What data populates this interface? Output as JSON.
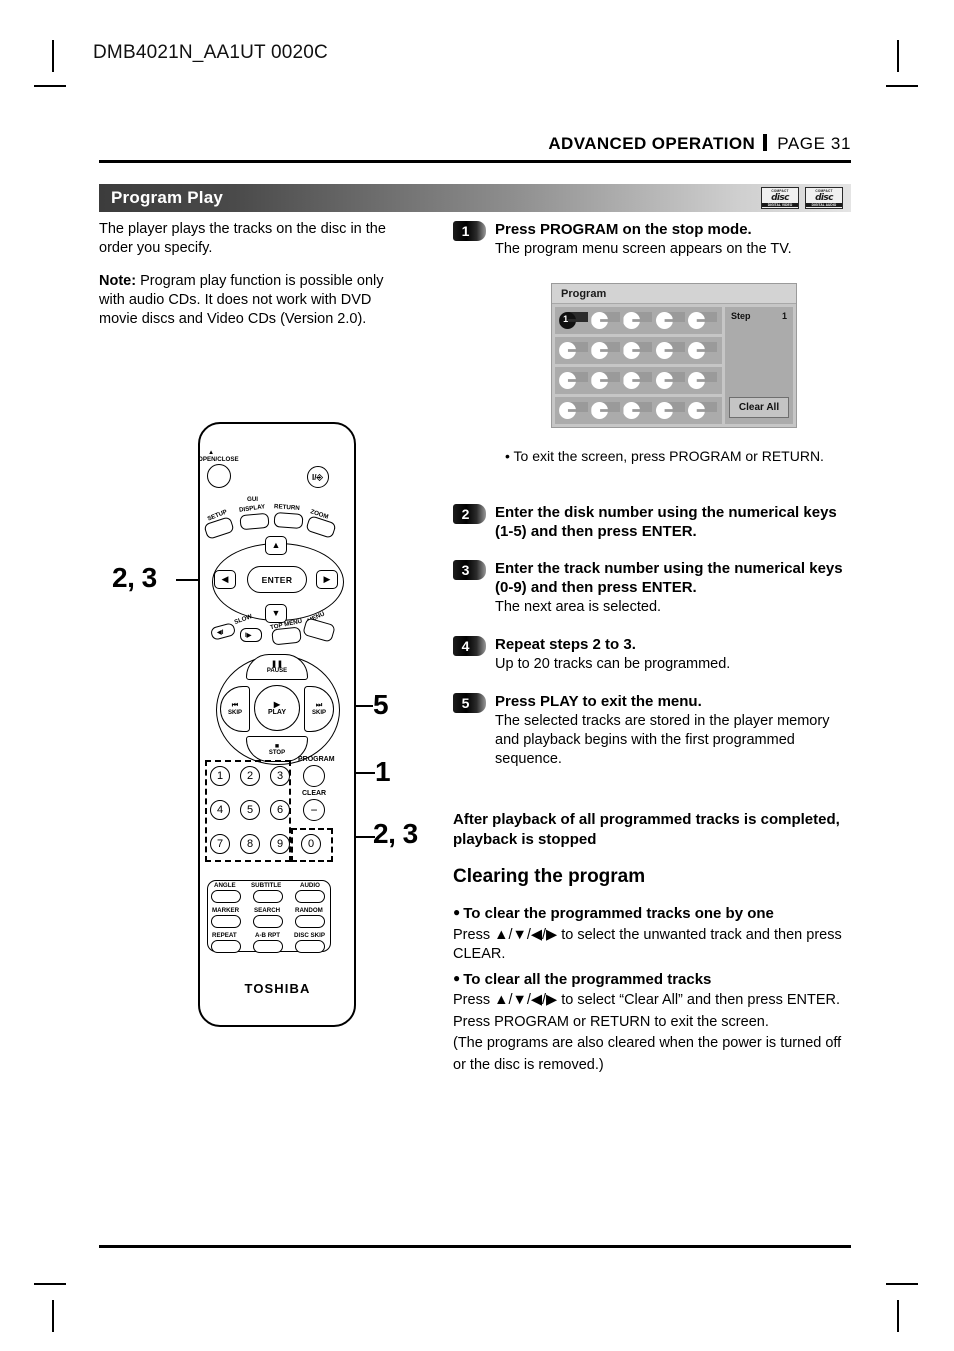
{
  "document": {
    "code": "DMB4021N_AA1UT 0020C",
    "section": "ADVANCED OPERATION",
    "page_label": "PAGE 31"
  },
  "title_bar": {
    "title": "Program Play",
    "logos": [
      {
        "name": "cd-video-logo",
        "top": "COMPACT",
        "word": "disc",
        "bottom": "DIGITAL VIDEO"
      },
      {
        "name": "cd-audio-logo",
        "top": "COMPACT",
        "word": "disc",
        "bottom": "DIGITAL AUDIO"
      }
    ]
  },
  "intro": {
    "paragraph": "The player plays the tracks on the disc in the order you specify.",
    "note_label": "Note:",
    "note_text": " Program play function is possible only with audio CDs. It does not work with DVD movie discs and Video CDs (Version 2.0)."
  },
  "steps": [
    {
      "number": "1",
      "title": "Press PROGRAM on the stop mode.",
      "body": "The program menu screen appears on the TV."
    },
    {
      "number": "2",
      "title": "Enter the disk number using the numerical keys (1-5) and then press ENTER.",
      "body": ""
    },
    {
      "number": "3",
      "title": "Enter the track number using the numerical keys (0-9) and then press ENTER.",
      "body": "The next area is selected."
    },
    {
      "number": "4",
      "title": "Repeat steps 2 to 3.",
      "body": "Up to 20 tracks can be programmed."
    },
    {
      "number": "5",
      "title": "Press PLAY to exit the menu.",
      "body": "The selected tracks are stored in the player memory and playback begins with the first programmed sequence."
    }
  ],
  "tv_screen": {
    "title": "Program",
    "step_label": "Step",
    "step_value": "1",
    "clear_all": "Clear All",
    "selected_cell_number": "1",
    "rows": 4,
    "cols": 5
  },
  "tv_note": "• To exit the screen, press PROGRAM or RETURN.",
  "after_note": "After playback of all programmed tracks is completed, playback is stopped",
  "clearing": {
    "heading": "Clearing the program",
    "bullet_one": "To clear the programmed tracks one by one",
    "body_one": "Press ▲/▼/◀/▶ to select the unwanted track and then press CLEAR.",
    "bullet_two": "To clear all the programmed tracks",
    "body_two_line1": "Press ▲/▼/◀/▶ to select “Clear All” and then press ENTER.",
    "body_two_line2": "Press PROGRAM or RETURN to exit the screen.",
    "body_two_line3": "(The programs are also cleared when the power is turned off",
    "body_two_line4": "or the disc is removed.)"
  },
  "callouts": [
    {
      "name": "callout-enter",
      "label": "2, 3"
    },
    {
      "name": "callout-play",
      "label": "5"
    },
    {
      "name": "callout-program",
      "label": "1"
    },
    {
      "name": "callout-numeric",
      "label": "2, 3"
    }
  ],
  "remote": {
    "brand": "TOSHIBA",
    "open_close": "OPEN/CLOSE",
    "power": "I/⏻",
    "row_setup": [
      "SETUP",
      "GUI",
      "DISPLAY",
      "RETURN",
      "ZOOM"
    ],
    "enter": "ENTER",
    "slow": "SLOW",
    "top_menu": "TOP MENU",
    "menu": "MENU",
    "pause": "PAUSE",
    "skip_left": "SKIP",
    "skip_right": "SKIP",
    "play": "PLAY",
    "stop": "STOP",
    "program": "PROGRAM",
    "clear": "CLEAR",
    "numeric_keys": [
      "1",
      "2",
      "3",
      "4",
      "5",
      "6",
      "7",
      "8",
      "9",
      "0"
    ],
    "function_buttons": [
      "ANGLE",
      "SUBTITLE",
      "AUDIO",
      "MARKER",
      "SEARCH",
      "RANDOM",
      "REPEAT",
      "A-B RPT",
      "DISC SKIP"
    ]
  }
}
